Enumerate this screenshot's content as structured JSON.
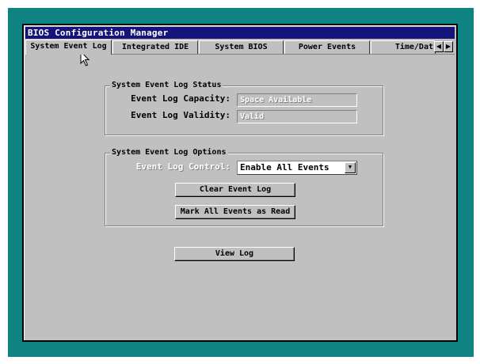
{
  "window": {
    "title": "BIOS Configuration Manager"
  },
  "tabs": [
    {
      "label": "System Event Log",
      "active": true
    },
    {
      "label": "Integrated IDE",
      "active": false
    },
    {
      "label": "System BIOS",
      "active": false
    },
    {
      "label": "Power Events",
      "active": false
    },
    {
      "label": "Time/Dat",
      "active": false
    }
  ],
  "tab_scroll": {
    "left_icon": "arrow-left",
    "right_icon": "arrow-right"
  },
  "status_group": {
    "title": "System Event Log Status",
    "capacity_label": "Event Log Capacity:",
    "capacity_value": "Space Available",
    "validity_label": "Event Log Validity:",
    "validity_value": "Valid"
  },
  "options_group": {
    "title": "System Event Log Options",
    "control_label": "Event Log Control:",
    "control_value": "Enable All Events",
    "clear_button": "Clear Event Log",
    "mark_read_button": "Mark All Events as Read"
  },
  "view_log_button": "View Log",
  "colors": {
    "desktop": "#0f8282",
    "titlebar": "#14147a",
    "face": "#c0c0c0"
  }
}
